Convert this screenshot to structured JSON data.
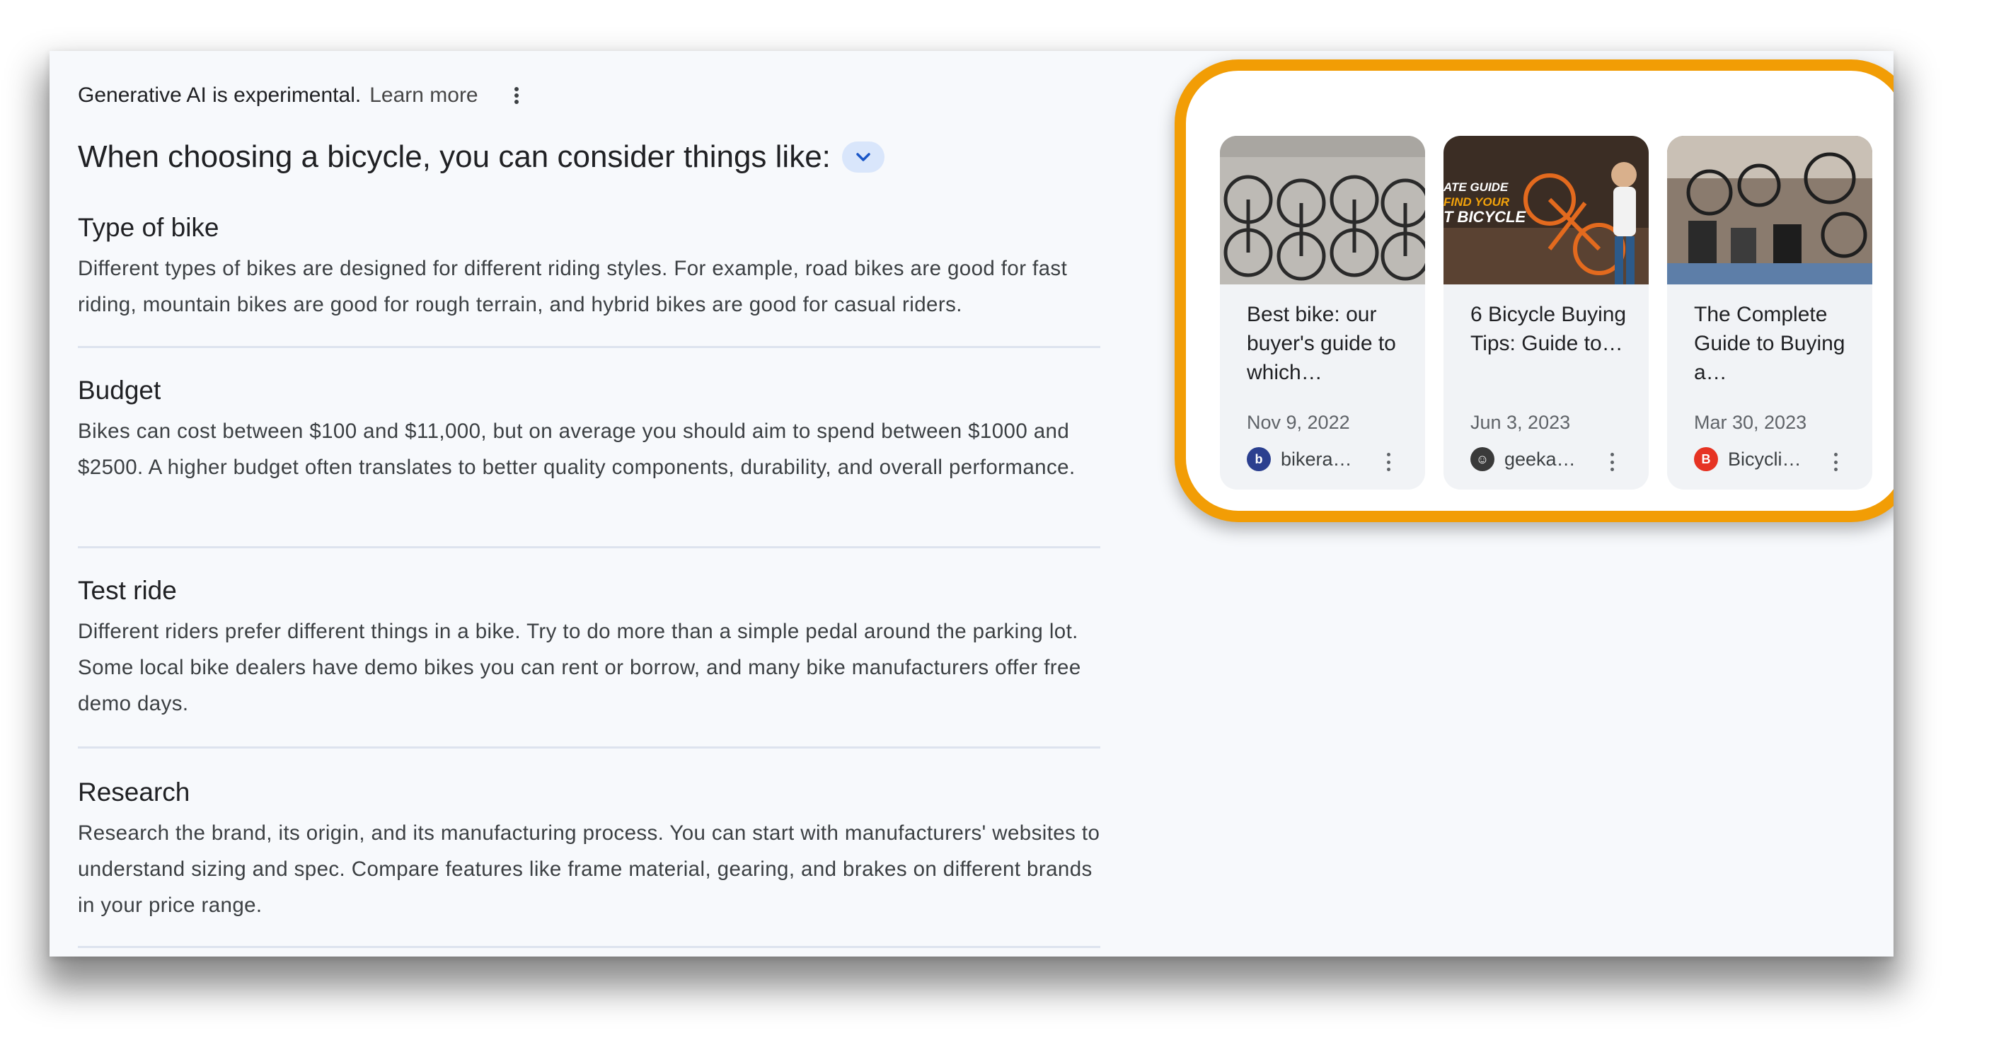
{
  "header": {
    "notice": "Generative AI is experimental.",
    "learn_more": "Learn more"
  },
  "headline": "When choosing a bicycle, you can consider things like:",
  "sections": [
    {
      "title": "Type of bike",
      "text": "Different types of bikes are designed for different riding styles. For example, road bikes are good for fast riding, mountain bikes are good for rough terrain, and hybrid bikes are good for casual riders."
    },
    {
      "title": "Budget",
      "text": "Bikes can cost between $100 and $11,000, but on average you should aim to spend between $1000 and $2500. A higher budget often translates to better quality components, durability, and overall performance."
    },
    {
      "title": "Test ride",
      "text": "Different riders prefer different things in a bike. Try to do more than a simple pedal around the parking lot. Some local bike dealers have demo bikes you can rent or borrow, and many bike manufacturers offer free demo days."
    },
    {
      "title": "Research",
      "text": "Research the brand, its origin, and its manufacturing process. You can start with manufacturers' websites to understand sizing and spec. Compare features like frame material, gearing, and brakes on different brands in your price range."
    }
  ],
  "cards": [
    {
      "title": "Best bike: our buyer's guide to which…",
      "date": "Nov 9, 2022",
      "source": "bikera…",
      "favicon_color": "#2b3f8f"
    },
    {
      "title": "6 Bicycle Buying Tips: Guide to…",
      "date": "Jun 3, 2023",
      "source": "geeka…",
      "favicon_color": "#3a3a3a",
      "thumb_text": [
        "ATE GUIDE",
        "FIND YOUR",
        "T BICYCLE"
      ]
    },
    {
      "title": "The Complete Guide to Buying a…",
      "date": "Mar 30, 2023",
      "source": "Bicycli…",
      "favicon_color": "#e63323"
    }
  ],
  "colors": {
    "highlight_border": "#f29d05",
    "chevron_bg": "#d9e6fb"
  }
}
